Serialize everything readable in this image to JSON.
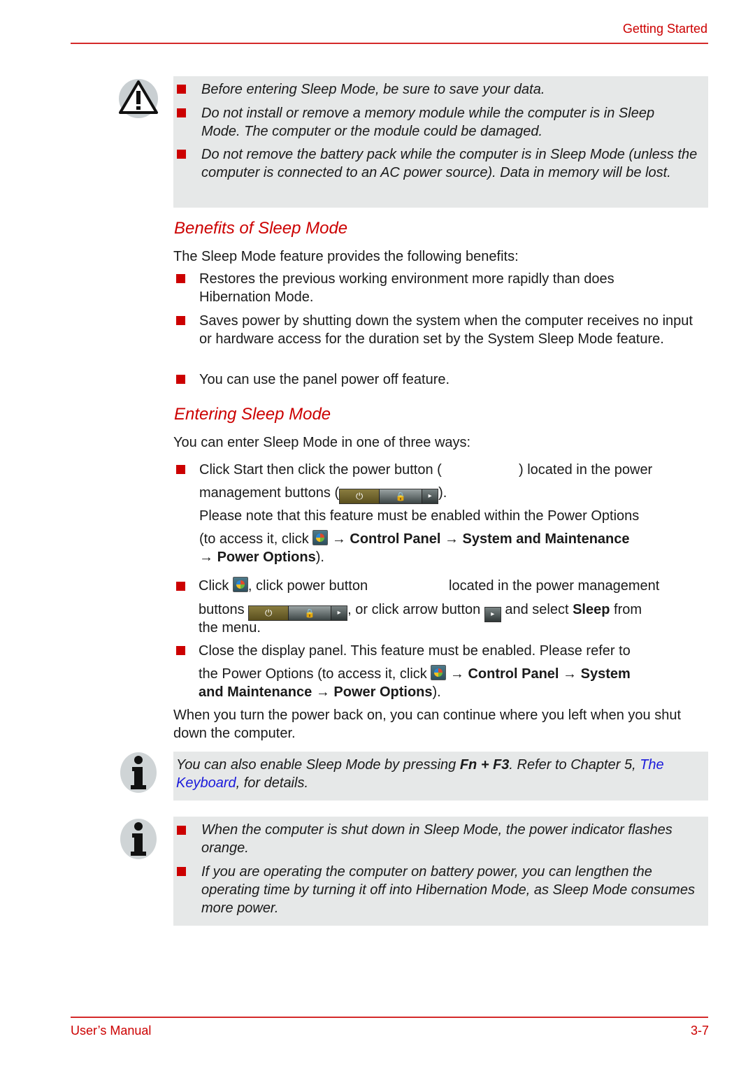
{
  "header": {
    "section": "Getting Started"
  },
  "warning_box": {
    "icon": "warning-triangle-icon",
    "items": [
      "Before entering Sleep Mode, be sure to save your data.",
      "Do not install or remove a memory module while the computer is in Sleep Mode. The computer or the module could be damaged.",
      "Do not remove the battery pack while the computer is in Sleep Mode (unless the computer is connected to an AC power source). Data in memory will be lost."
    ]
  },
  "benefits": {
    "heading": "Benefits of Sleep Mode",
    "intro": "The Sleep Mode feature provides the following benefits:",
    "items": [
      "Restores the previous working environment more rapidly than does Hibernation Mode.",
      "Saves power by shutting down the system when the computer receives no input or hardware access for the duration set by the System Sleep Mode feature.",
      "You can use the panel power off feature."
    ]
  },
  "entering": {
    "heading": "Entering Sleep Mode",
    "intro": "You can enter Sleep Mode in one of three ways:",
    "item1": {
      "a": "Click Start then click the power button (",
      "b": ") located in the power",
      "c": "management buttons (",
      "d": ").",
      "note1": "Please note that this feature must be enabled within the Power Options",
      "note2a": "(to access it, click ",
      "arrow": "→",
      "control_panel": "Control Panel",
      "system_maint": "System and Maintenance",
      "power_options": "Power Options",
      "close_paren": ")."
    },
    "item2": {
      "a": "Click ",
      "b": ", click power button",
      "c": "located in the power management",
      "d": "buttons ",
      "e": ", or click arrow button ",
      "f": " and select ",
      "sleep": "Sleep",
      "g": " from",
      "h": "the menu."
    },
    "item3": {
      "a": "Close the display panel. This feature must be enabled. Please refer to",
      "b": "the Power Options (to access it, click ",
      "control_panel": "Control Panel",
      "system": "System",
      "and_maint": "and Maintenance",
      "power_options": "Power Options",
      "close_paren": ")."
    },
    "outro": "When you turn the power back on, you can continue where you left when you shut down the computer."
  },
  "power_buttons": {
    "power_glyph": "⏻",
    "lock_glyph": "🔒",
    "arrow_glyph": "▸"
  },
  "note1": {
    "a": "You can also enable Sleep Mode by pressing ",
    "keys": "Fn + F3",
    "b": ". Refer to Chapter 5,",
    "link": "The Keyboard",
    "c": ", for details."
  },
  "note2": {
    "items": [
      "When the computer is shut down in Sleep Mode, the power indicator flashes orange.",
      "If you are operating the computer on battery power, you can lengthen the operating time by turning it off into Hibernation Mode, as Sleep Mode consumes more power."
    ]
  },
  "footer": {
    "left": "User’s Manual",
    "right": "3-7"
  }
}
